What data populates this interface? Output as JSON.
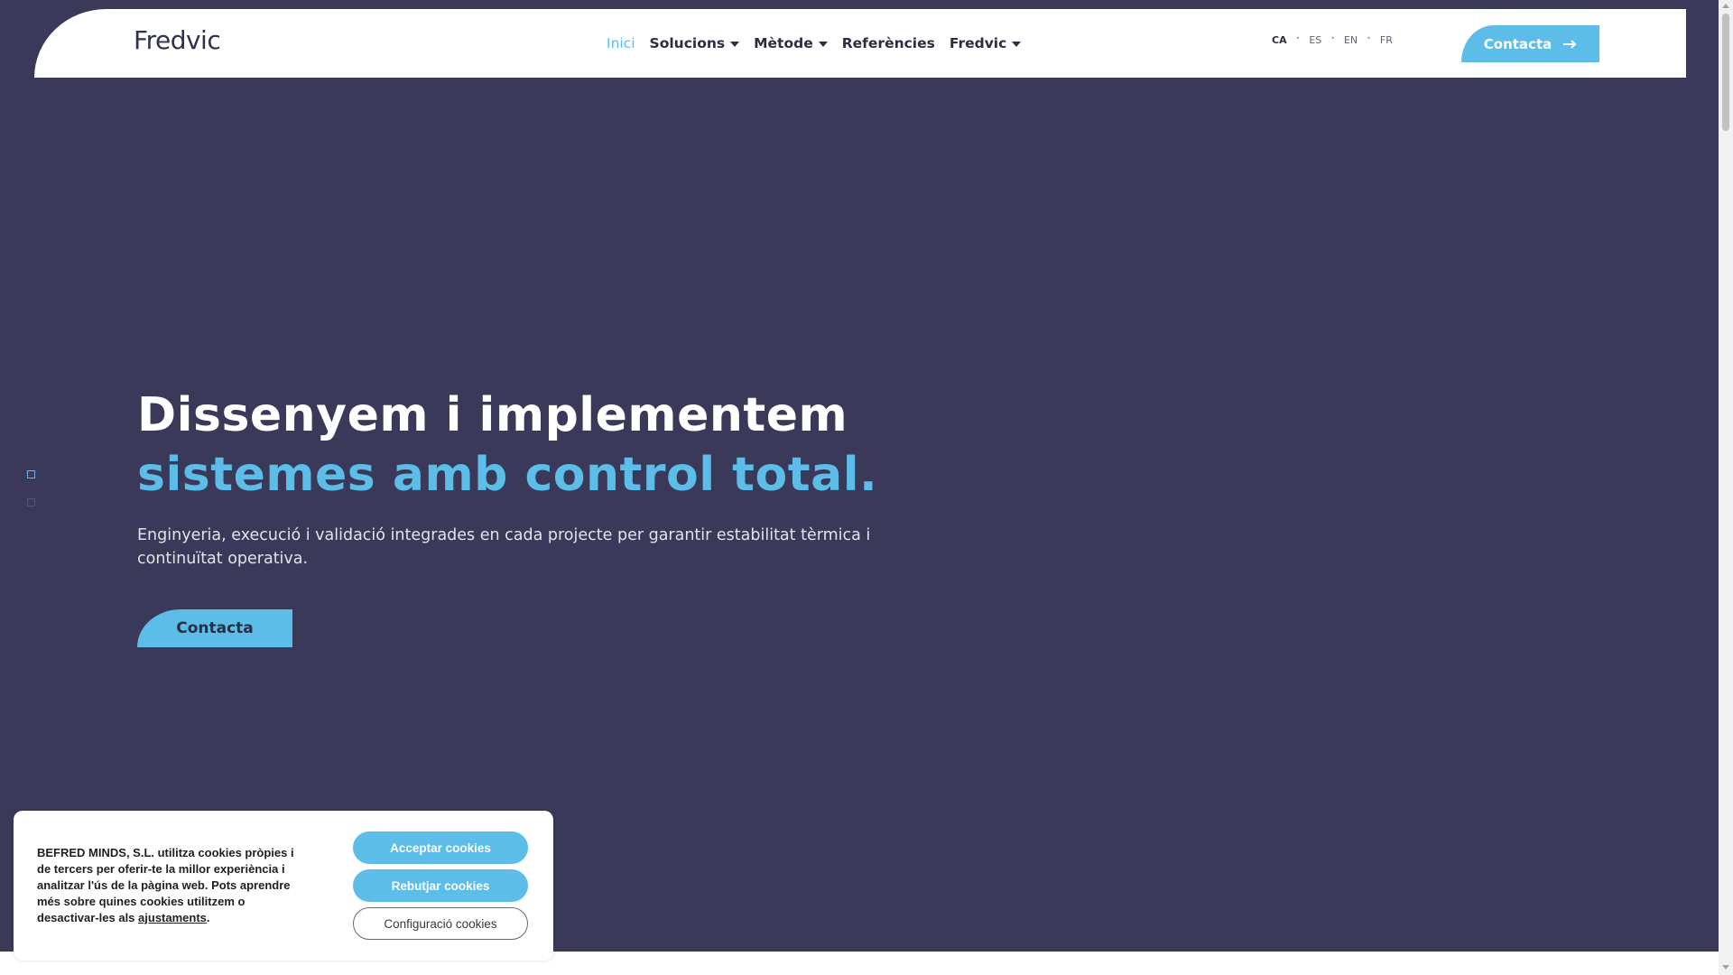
{
  "header": {
    "logo_text": "Fredvic",
    "nav": [
      {
        "label": "Inici",
        "active": true,
        "dropdown": false
      },
      {
        "label": "Solucions",
        "active": false,
        "dropdown": true
      },
      {
        "label": "Mètode",
        "active": false,
        "dropdown": true
      },
      {
        "label": "Referències",
        "active": false,
        "dropdown": false
      },
      {
        "label": "Fredvic",
        "active": false,
        "dropdown": true
      }
    ],
    "languages": [
      "CA",
      "ES",
      "EN",
      "FR"
    ],
    "current_language": "CA",
    "contact_label": "Contacta",
    "contact_icon": "arrow-right-icon"
  },
  "hero": {
    "headline_line1": "Dissenyem i implementem",
    "headline_line2": "sistemes amb control total.",
    "subtext": "Enginyeria, execució i validació integrades en cada projecte per garantir estabilitat tèrmica i continuïtat operativa.",
    "cta_label": "Contacta",
    "slide_count": 2,
    "active_slide": 1
  },
  "cookie_banner": {
    "text_before_link": "BEFRED MINDS, S.L. utilitza cookies pròpies i de tercers per oferir-te la millor experiència i analitzar l'ús de la pàgina web. Pots aprendre més sobre quines cookies utilitzem o desactivar-les als ",
    "link_text": "ajustaments",
    "text_after_link": ".",
    "accept_label": "Acceptar cookies",
    "reject_label": "Rebutjar cookies",
    "settings_label": "Configuració cookies"
  },
  "colors": {
    "hero_background": "#3a3959",
    "accent": "#5bbde8",
    "header_background": "#ffffff",
    "text_dark": "#2b2d42"
  }
}
